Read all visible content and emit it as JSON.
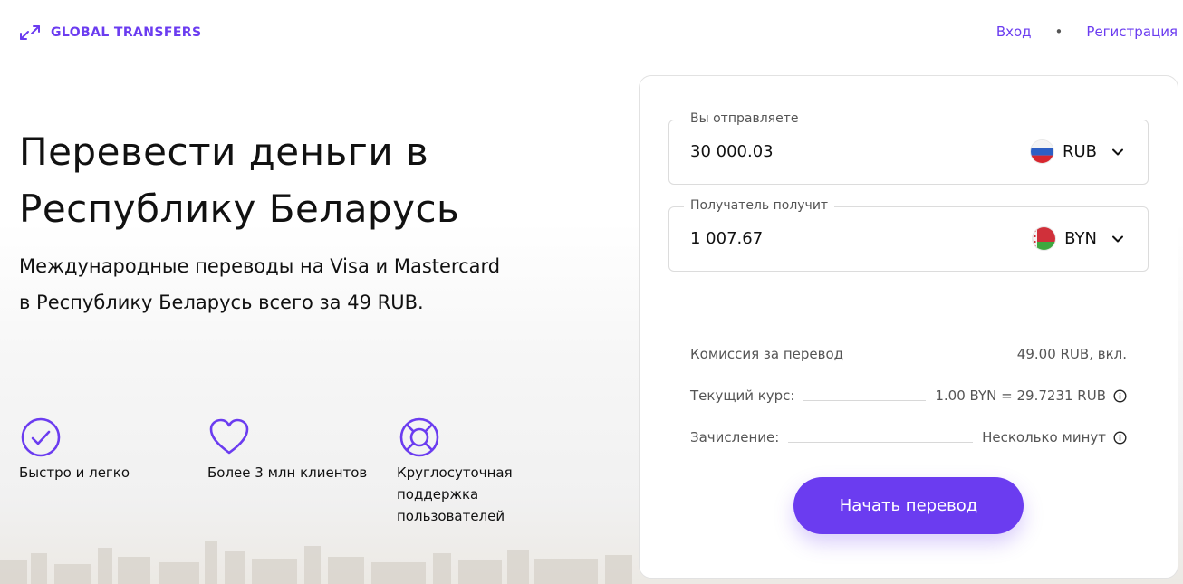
{
  "header": {
    "logo_text": "GLOBAL TRANSFERS",
    "login": "Вход",
    "separator": "•",
    "register": "Регистрация"
  },
  "hero": {
    "title_line1": "Перевести деньги в",
    "title_line2": "Республику Беларусь",
    "subtitle": "Международные переводы на Visa и Mastercard в Республику Беларусь всего за 49 RUB."
  },
  "features": [
    {
      "label": "Быстро и легко",
      "icon": "check-circle-icon"
    },
    {
      "label": "Более 3 млн клиентов",
      "icon": "heart-icon"
    },
    {
      "label": "Круглосуточная поддержка пользователей",
      "icon": "lifebuoy-icon"
    }
  ],
  "form": {
    "send": {
      "legend": "Вы отправляете",
      "value": "30 000.03",
      "currency": "RUB",
      "flag": "russia-flag-icon"
    },
    "receive": {
      "legend": "Получатель получит",
      "value": "1 007.67",
      "currency": "BYN",
      "flag": "belarus-flag-icon"
    },
    "fee": {
      "label": "Комиссия за перевод",
      "value": "49.00 RUB, вкл."
    },
    "rate": {
      "label": "Текущий курс:",
      "value": "1.00 BYN = 29.7231 RUB"
    },
    "eta": {
      "label": "Зачисление:",
      "value": "Несколько минут"
    },
    "submit_label": "Начать перевод"
  },
  "colors": {
    "accent": "#6b3cf0"
  }
}
